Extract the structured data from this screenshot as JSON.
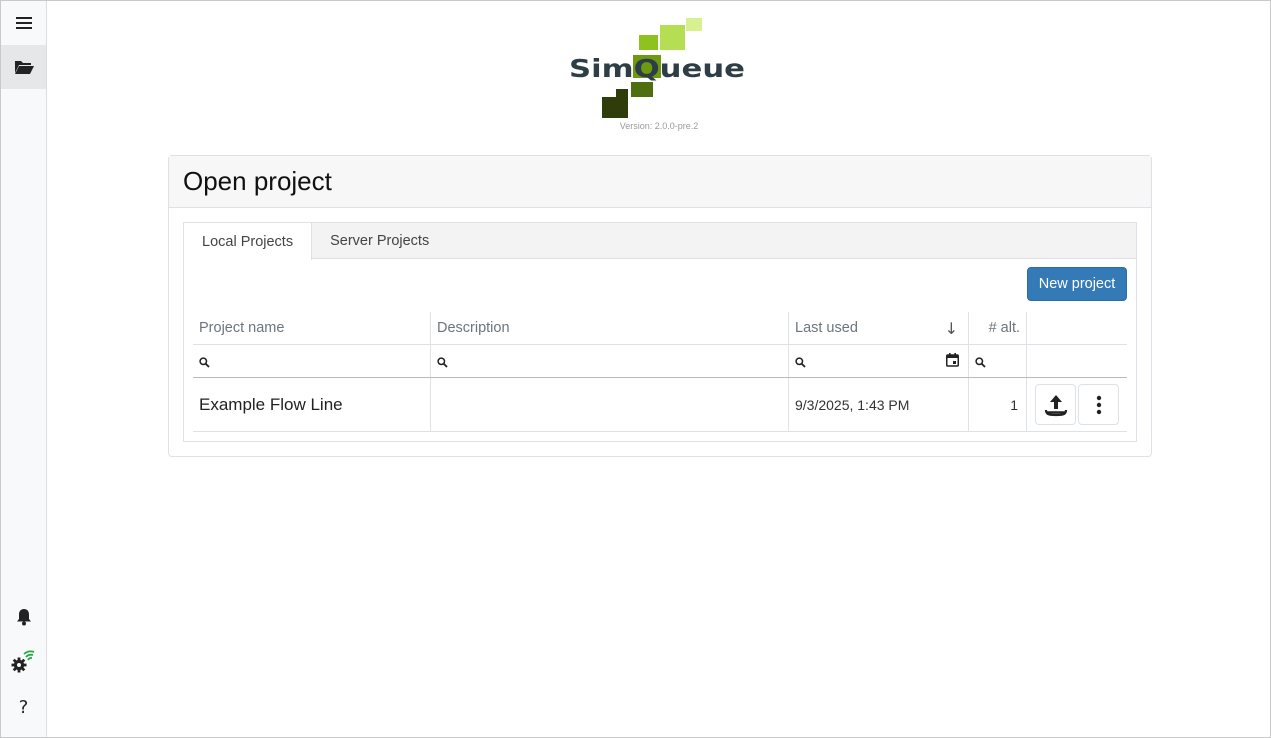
{
  "logo": {
    "wordmark": "SimQueue",
    "version": "Version: 2.0.0-pre.2"
  },
  "sidebar": {
    "icons": [
      "menu-icon",
      "folder-open-icon",
      "bell-icon",
      "gear-wifi-icon",
      "help-icon"
    ],
    "help_glyph": "?"
  },
  "card": {
    "title": "Open project"
  },
  "tabs": [
    {
      "label": "Local Projects",
      "active": true
    },
    {
      "label": "Server Projects",
      "active": false
    }
  ],
  "toolbar": {
    "new_project_label": "New project"
  },
  "table": {
    "columns": [
      "Project name",
      "Description",
      "Last used",
      "# alt."
    ],
    "sort_indicator": "↓",
    "filters": {
      "name": "",
      "description": "",
      "last_used": "",
      "alt": ""
    },
    "rows": [
      {
        "name": "Example Flow Line",
        "description": "",
        "last_used": "9/3/2025, 1:43 PM",
        "alt": "1"
      }
    ]
  },
  "colors": {
    "primary": "#337ab7",
    "logo_dark": "#2d3e47",
    "logo_green_dark": "#2f3d0a",
    "logo_green": "#8dc21f",
    "logo_green_light": "#d8f090",
    "wifi": "#28a745"
  }
}
